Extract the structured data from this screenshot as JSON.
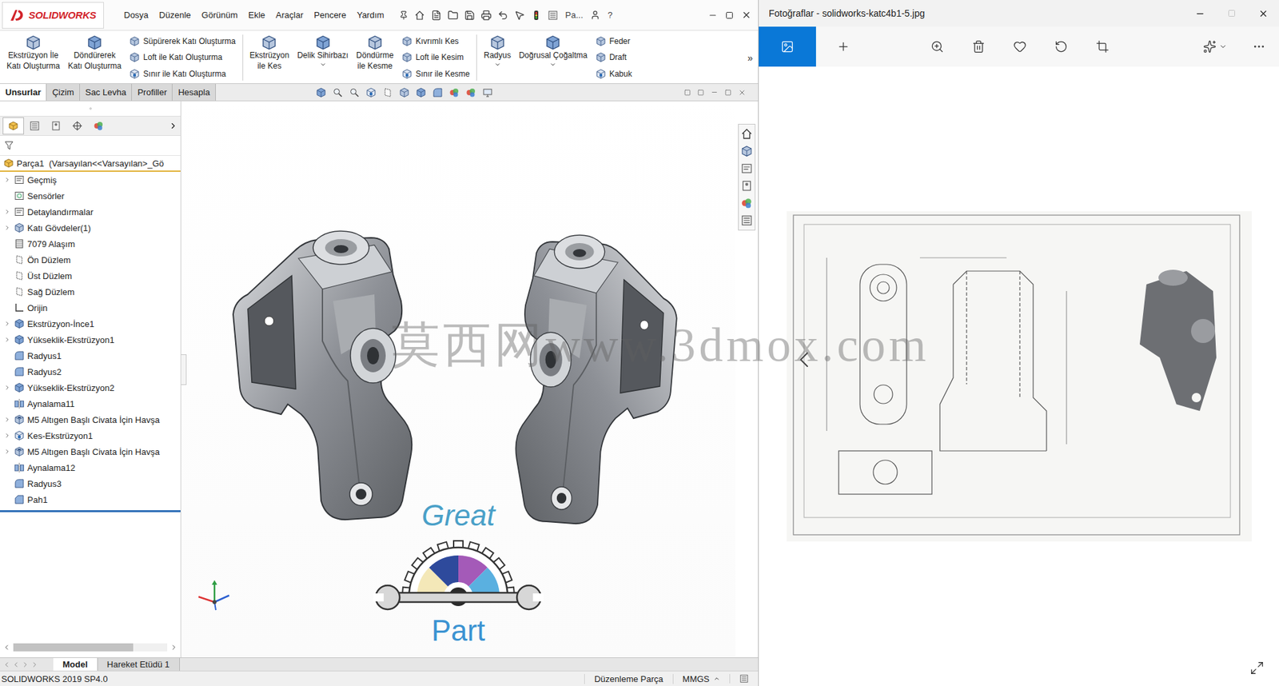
{
  "solidworks": {
    "logo": "SOLIDWORKS",
    "menu": [
      "Dosya",
      "Düzenle",
      "Görünüm",
      "Ekle",
      "Araçlar",
      "Pencere",
      "Yardım"
    ],
    "search_label": "Pa...",
    "help": "?",
    "ribbon_groups": [
      [
        {
          "kind": "large",
          "lines": [
            "Ekstrüzyon İle",
            "Katı Oluşturma"
          ],
          "dropdown": false
        },
        {
          "kind": "large",
          "lines": [
            "Döndürerek",
            "Katı Oluşturma"
          ],
          "dropdown": false
        },
        {
          "kind": "stack",
          "lines": [
            "Süpürerek Katı Oluşturma",
            "Loft ile Katı Oluşturma",
            "Sınır ile Katı Oluşturma"
          ],
          "dropdown": false
        }
      ],
      [
        {
          "kind": "large",
          "lines": [
            "Ekstrüzyon",
            "ile Kes"
          ],
          "dropdown": false
        },
        {
          "kind": "large",
          "lines": [
            "Delik Sihirbazı"
          ],
          "dropdown": true
        },
        {
          "kind": "large",
          "lines": [
            "Döndürme",
            "ile Kesme"
          ],
          "dropdown": false
        },
        {
          "kind": "stack",
          "lines": [
            "Kıvrımlı Kes",
            "Loft ile Kesim",
            "Sınır ile Kesme"
          ],
          "dropdown": false
        }
      ],
      [
        {
          "kind": "large",
          "lines": [
            "Radyus"
          ],
          "dropdown": true
        },
        {
          "kind": "large",
          "lines": [
            "Doğrusal Çoğaltma"
          ],
          "dropdown": true
        },
        {
          "kind": "stack",
          "lines": [
            "Feder",
            "Draft",
            "Kabuk"
          ],
          "dropdown": false
        }
      ]
    ],
    "ribbon_more": "»",
    "tabs": [
      {
        "label": "Unsurlar",
        "selected": true
      },
      {
        "label": "Çizim",
        "selected": false
      },
      {
        "label": "Sac Levha",
        "selected": false
      },
      {
        "label": "Profiller",
        "selected": false
      },
      {
        "label": "Hesapla",
        "selected": false
      }
    ],
    "tree": {
      "root": "Parça1  (Varsayılan<<Varsayılan>_Gö",
      "items": [
        {
          "label": "Geçmiş",
          "kind": "history",
          "expandable": true,
          "expanded": false
        },
        {
          "label": "Sensörler",
          "kind": "sensor",
          "expandable": false,
          "expanded": false
        },
        {
          "label": "Detaylandırmalar",
          "kind": "annotation",
          "expandable": true,
          "expanded": false
        },
        {
          "label": "Katı Gövdeler(1)",
          "kind": "bodies",
          "expandable": true,
          "expanded": false
        },
        {
          "label": "7079 Alaşım",
          "kind": "material",
          "expandable": false,
          "expanded": false
        },
        {
          "label": "Ön Düzlem",
          "kind": "plane",
          "expandable": false,
          "expanded": false
        },
        {
          "label": "Üst Düzlem",
          "kind": "plane",
          "expandable": false,
          "expanded": false
        },
        {
          "label": "Sağ Düzlem",
          "kind": "plane",
          "expandable": false,
          "expanded": false
        },
        {
          "label": "Orijin",
          "kind": "origin",
          "expandable": false,
          "expanded": false
        },
        {
          "label": "Ekstrüzyon-İnce1",
          "kind": "feature",
          "expandable": true,
          "expanded": false
        },
        {
          "label": "Yükseklik-Ekstrüzyon1",
          "kind": "feature",
          "expandable": true,
          "expanded": false
        },
        {
          "label": "Radyus1",
          "kind": "fillet",
          "expandable": false,
          "expanded": false
        },
        {
          "label": "Radyus2",
          "kind": "fillet",
          "expandable": false,
          "expanded": false
        },
        {
          "label": "Yükseklik-Ekstrüzyon2",
          "kind": "feature",
          "expandable": true,
          "expanded": false
        },
        {
          "label": "Aynalama11",
          "kind": "mirror",
          "expandable": false,
          "expanded": false
        },
        {
          "label": "M5 Altıgen Başlı Civata İçin Havşa",
          "kind": "hole",
          "expandable": true,
          "expanded": false
        },
        {
          "label": "Kes-Ekstrüzyon1",
          "kind": "cut",
          "expandable": true,
          "expanded": false
        },
        {
          "label": "M5 Altıgen Başlı Civata İçin Havşa",
          "kind": "hole",
          "expandable": true,
          "expanded": false
        },
        {
          "label": "Aynalama12",
          "kind": "mirror",
          "expandable": false,
          "expanded": false
        },
        {
          "label": "Radyus3",
          "kind": "fillet",
          "expandable": false,
          "expanded": false
        },
        {
          "label": "Pah1",
          "kind": "chamfer",
          "expandable": false,
          "expanded": false
        }
      ]
    },
    "viewport": {
      "logo_top": "Great",
      "logo_bottom": "Part"
    },
    "bottom_tabs": [
      {
        "label": "Model",
        "selected": true
      },
      {
        "label": "Hareket Etüdü 1",
        "selected": false
      }
    ],
    "status": {
      "version": "SOLIDWORKS 2019 SP4.0",
      "mode": "Düzenleme Parça",
      "units": "MMGS"
    }
  },
  "photos": {
    "title": "Fotoğraflar - solidworks-katc4b1-5.jpg",
    "toolbar": [
      {
        "selected": true
      },
      {
        "selected": false
      },
      {
        "selected": false
      },
      {
        "selected": false
      },
      {
        "selected": false
      },
      {
        "selected": false
      },
      {
        "selected": false
      },
      {
        "selected": false
      },
      {
        "selected": false
      }
    ],
    "window_controls_disabled": [
      false,
      true,
      false
    ]
  },
  "watermark": "莫西网www.3dmox.com"
}
